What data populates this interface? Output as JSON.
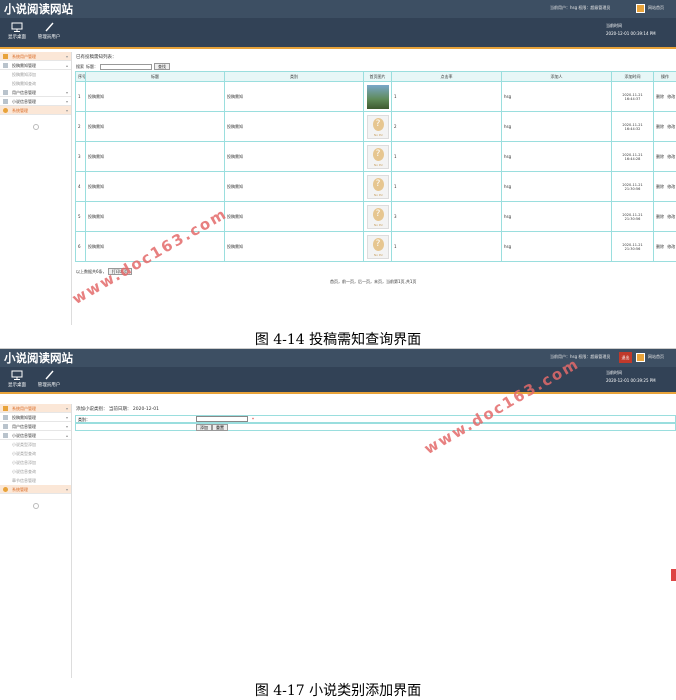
{
  "screen1": {
    "app_title": "小说阅读网站",
    "user_info": "当前用户：hsg 权限：超级管理员",
    "exit_label": "退出",
    "home_label": "网站首页",
    "nav": [
      "显示桌面",
      "管理员用户"
    ],
    "time_label": "当前时间",
    "time_value": "2020-12-01 00:39:14 PM",
    "sidebar": [
      {
        "label": "系统用户管理",
        "type": "active"
      },
      {
        "label": "投稿需知管理",
        "type": "item"
      },
      {
        "label": "投稿需知添加",
        "type": "sub"
      },
      {
        "label": "投稿需知查询",
        "type": "sub"
      },
      {
        "label": "用户信息管理",
        "type": "item"
      },
      {
        "label": "小说信息管理",
        "type": "item"
      },
      {
        "label": "系统管理",
        "type": "sysact"
      }
    ],
    "breadcrumb": "已有投稿需知列表：",
    "search_prefix": "搜索",
    "search_label": "标题：",
    "search_button": "查找",
    "table": {
      "headers": [
        "序号",
        "标题",
        "类别",
        "首页图片",
        "点击率",
        "添加人",
        "添加时间",
        "操作"
      ],
      "rows": [
        {
          "no": "1",
          "title": "投稿需知",
          "category": "投稿需知",
          "image": "photo",
          "clicks": "1",
          "author": "hsg",
          "time": "2020-11-21 16:44:37",
          "ops": "删除 修改"
        },
        {
          "no": "2",
          "title": "投稿需知",
          "category": "投稿需知",
          "image": "nopic",
          "clicks": "2",
          "author": "hsg",
          "time": "2020-11-21 16:44:32",
          "ops": "删除 修改"
        },
        {
          "no": "3",
          "title": "投稿需知",
          "category": "投稿需知",
          "image": "nopic",
          "clicks": "1",
          "author": "hsg",
          "time": "2020-11-21 16:44:28",
          "ops": "删除 修改"
        },
        {
          "no": "4",
          "title": "投稿需知",
          "category": "投稿需知",
          "image": "nopic",
          "clicks": "1",
          "author": "hsg",
          "time": "2020-11-21 21:30:56",
          "ops": "删除 修改"
        },
        {
          "no": "5",
          "title": "投稿需知",
          "category": "投稿需知",
          "image": "nopic",
          "clicks": "3",
          "author": "hsg",
          "time": "2020-11-21 21:30:56",
          "ops": "删除 修改"
        },
        {
          "no": "6",
          "title": "投稿需知",
          "category": "投稿需知",
          "image": "nopic",
          "clicks": "1",
          "author": "hsg",
          "time": "2020-11-21 21:30:56",
          "ops": "删除 修改"
        }
      ],
      "nopic_text": "No Pic"
    },
    "footer_note": "以上数据共6条，",
    "print_button": "打印本页",
    "pager": "首页，前一页，后一页，末页，当前第1页,共1页"
  },
  "caption1": "图 4-14 投稿需知查询界面",
  "screen2": {
    "app_title": "小说阅读网站",
    "user_info": "当前用户：hsg 权限：超级管理员",
    "exit_label": "退出",
    "home_label": "网站首页",
    "nav": [
      "显示桌面",
      "管理员用户"
    ],
    "time_label": "当前时间",
    "time_value": "2020-12-01 00:39:25 PM",
    "sidebar": [
      {
        "label": "系统用户管理",
        "type": "active"
      },
      {
        "label": "投稿需知管理",
        "type": "item"
      },
      {
        "label": "用户信息管理",
        "type": "item"
      },
      {
        "label": "小说信息管理",
        "type": "item"
      },
      {
        "label": "小说类型添加",
        "type": "sub"
      },
      {
        "label": "小说类型查询",
        "type": "sub"
      },
      {
        "label": "小说信息添加",
        "type": "sub"
      },
      {
        "label": "小说信息查询",
        "type": "sub"
      },
      {
        "label": "章节信息管理",
        "type": "sub"
      },
      {
        "label": "系统管理",
        "type": "sysact"
      }
    ],
    "breadcrumb": "添加小说类别：  当前日期：  2020-12-01",
    "form_label": "类别：",
    "required_mark": "*",
    "add_button": "添加",
    "reset_button": "重置"
  },
  "caption2": "图 4-17 小说类别添加界面",
  "watermark": "www.doc163.com"
}
